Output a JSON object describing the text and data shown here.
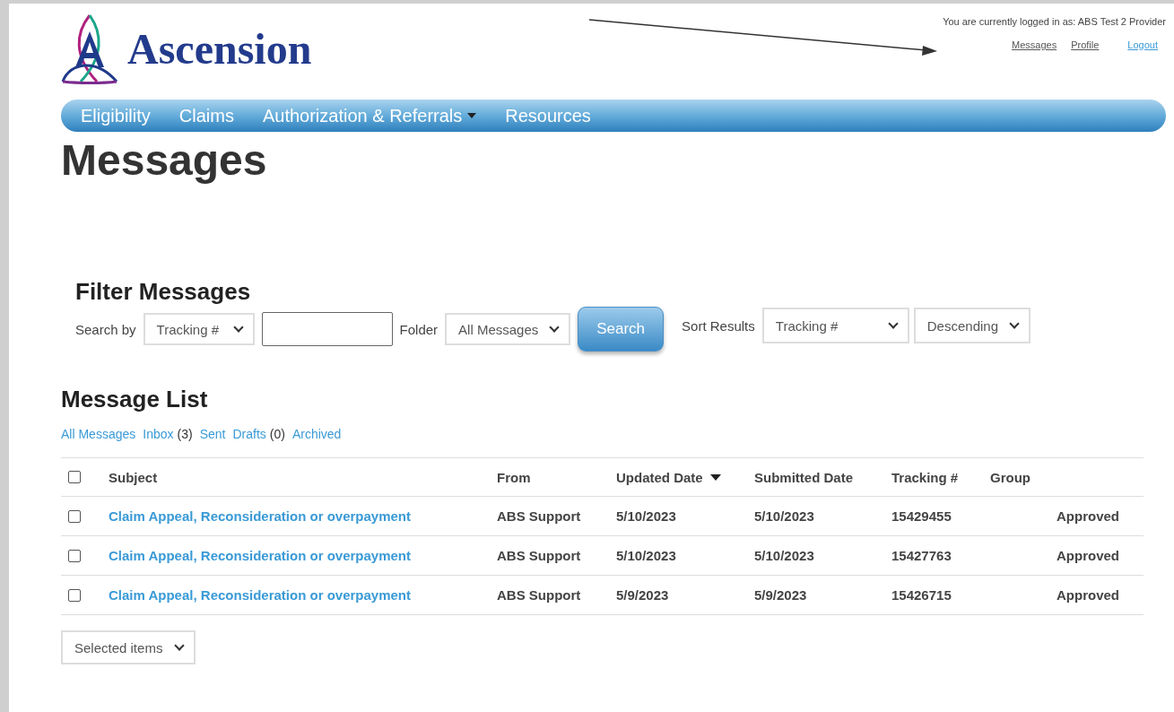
{
  "header": {
    "brand": "Ascension",
    "login_text": "You are currently logged in as: ABS Test 2 Provider",
    "user_links": [
      {
        "label": "Messages",
        "kind": "plain"
      },
      {
        "label": "Profile",
        "kind": "plain"
      },
      {
        "label": "Logout",
        "kind": "link"
      }
    ]
  },
  "nav": [
    {
      "label": "Eligibility",
      "has_dropdown": false
    },
    {
      "label": "Claims",
      "has_dropdown": false
    },
    {
      "label": "Authorization & Referrals",
      "has_dropdown": true
    },
    {
      "label": "Resources",
      "has_dropdown": false
    }
  ],
  "page_title": "Messages",
  "filter": {
    "title": "Filter Messages",
    "search_by_label": "Search by",
    "search_by_value": "Tracking #",
    "folder_label": "Folder",
    "folder_value": "All Messages",
    "search_button": "Search",
    "sort_label": "Sort Results",
    "sort_value": "Tracking #",
    "order_value": "Descending"
  },
  "message_list": {
    "title": "Message List",
    "folders": [
      {
        "label": "All Messages"
      },
      {
        "label": "Inbox",
        "count": "(3)"
      },
      {
        "label": "Sent"
      },
      {
        "label": "Drafts",
        "count": "(0)"
      },
      {
        "label": "Archived"
      }
    ],
    "select_all_checked": false,
    "columns": [
      {
        "label": "Subject",
        "sorted": false
      },
      {
        "label": "From",
        "sorted": false
      },
      {
        "label": "Updated Date",
        "sorted": true
      },
      {
        "label": "Submitted Date",
        "sorted": false
      },
      {
        "label": "Tracking #",
        "sorted": false
      },
      {
        "label": "Group",
        "sorted": false
      }
    ],
    "rows": [
      {
        "checked": false,
        "subject": "Claim Appeal, Reconsideration or overpayment",
        "from": "ABS Support",
        "updated_date": "5/10/2023",
        "submitted_date": "5/10/2023",
        "tracking": "15429455",
        "column_8": "Approved"
      },
      {
        "checked": false,
        "subject": "Claim Appeal, Reconsideration or overpayment",
        "from": "ABS Support",
        "updated_date": "5/10/2023",
        "submitted_date": "5/10/2023",
        "tracking": "15427763",
        "column_8": "Approved"
      },
      {
        "checked": false,
        "subject": "Claim Appeal, Reconsideration or overpayment",
        "from": "ABS Support",
        "updated_date": "5/9/2023",
        "submitted_date": "5/9/2023",
        "tracking": "15426715",
        "column_8": "Approved"
      }
    ],
    "bulk_action": "Selected items"
  }
}
